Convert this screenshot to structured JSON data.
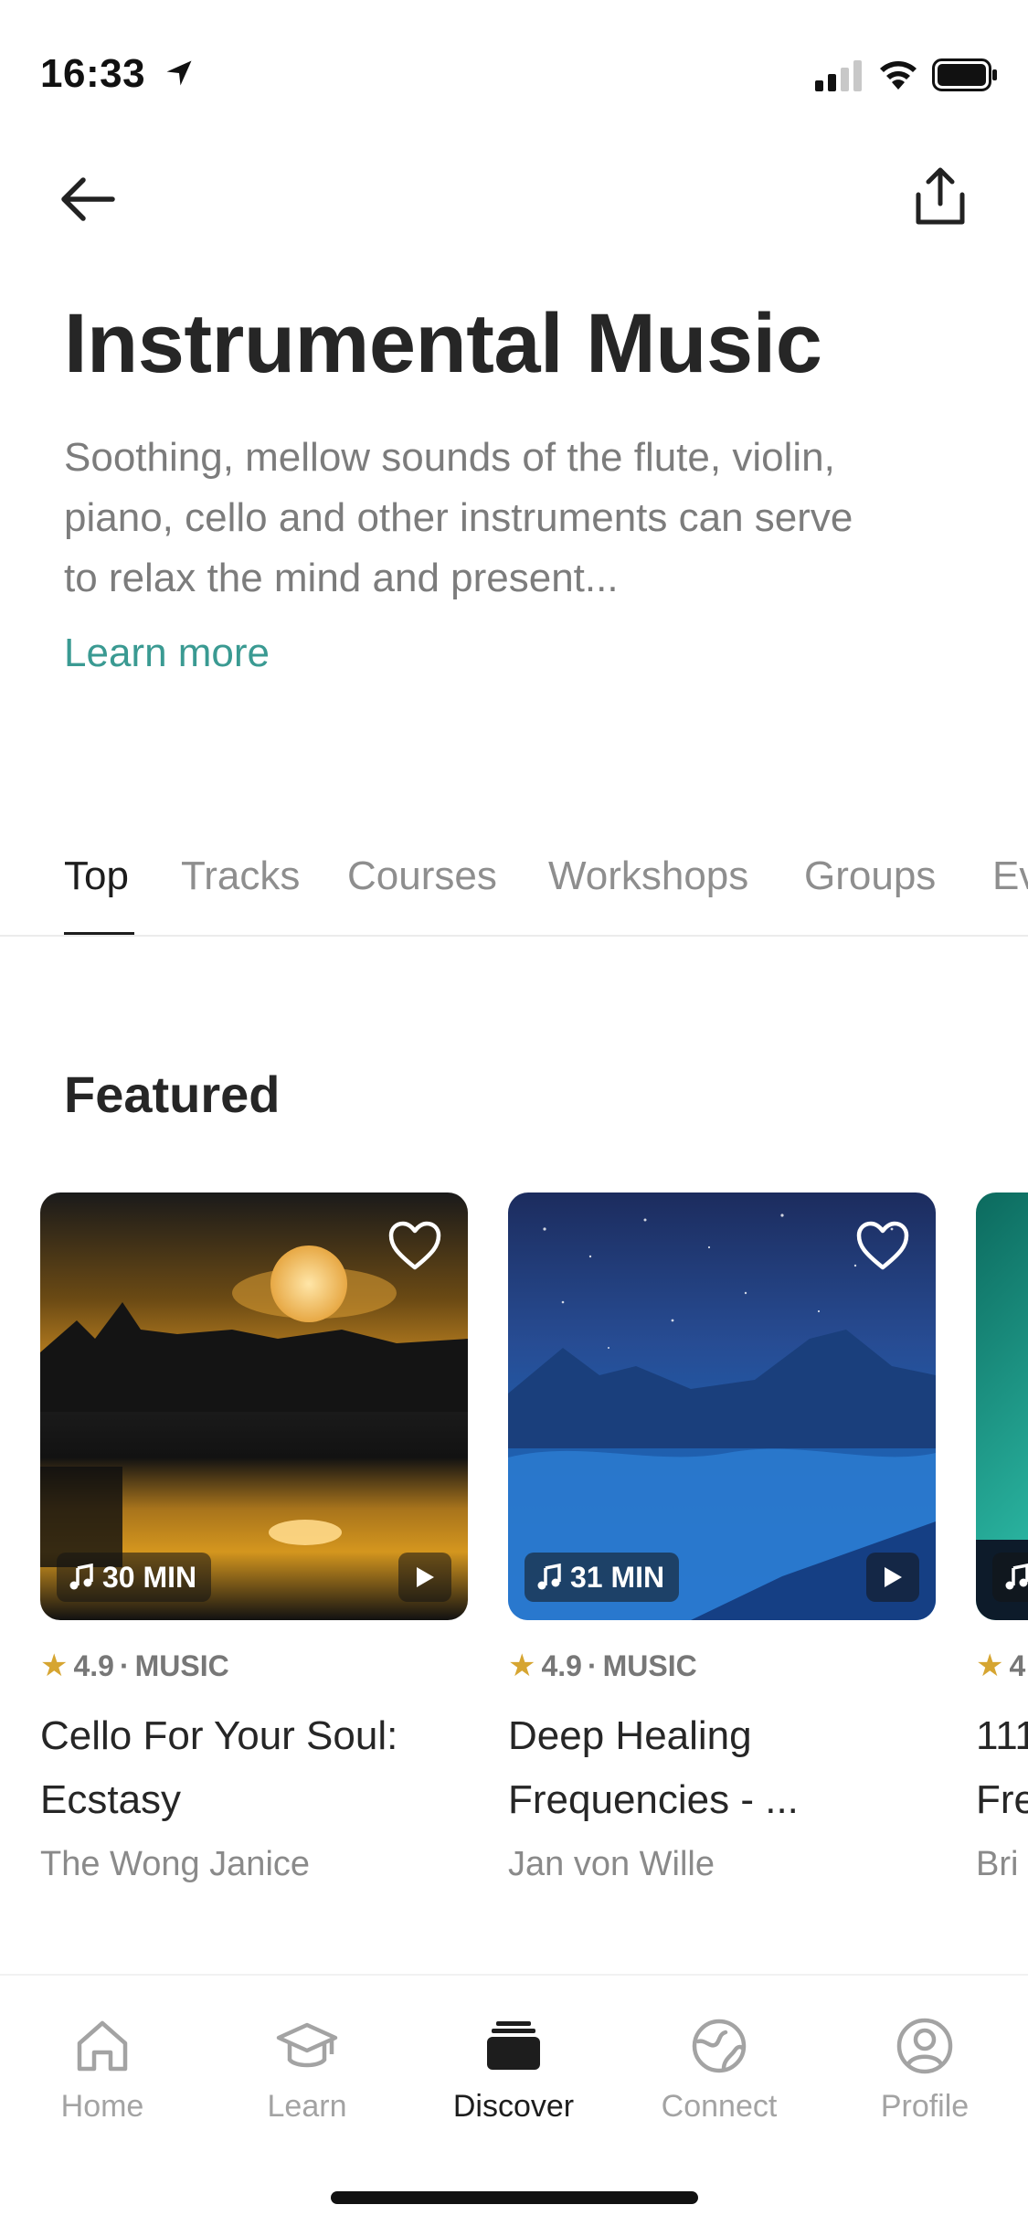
{
  "status_bar": {
    "time": "16:33"
  },
  "header": {
    "title": "Instrumental Music",
    "description": "Soothing, mellow sounds of the flute, violin, piano, cello and other instruments can serve to relax the mind and present...",
    "learn_more": "Learn more"
  },
  "tabs": [
    "Top",
    "Tracks",
    "Courses",
    "Workshops",
    "Groups",
    "Ev"
  ],
  "active_tab": "Top",
  "featured": {
    "title": "Featured",
    "cards": [
      {
        "duration": "30 MIN",
        "rating": "4.9",
        "category": "MUSIC",
        "title": "Cello For Your Soul: Ecstasy",
        "author": "The Wong Janice"
      },
      {
        "duration": "31 MIN",
        "rating": "4.9",
        "category": "MUSIC",
        "title": "Deep Healing Frequencies - ...",
        "author": "Jan von Wille"
      },
      {
        "duration": "",
        "rating": "4",
        "category": "",
        "title": "111\nFre",
        "author": "Bri"
      }
    ]
  },
  "nav": {
    "items": [
      "Home",
      "Learn",
      "Discover",
      "Connect",
      "Profile"
    ],
    "active": "Discover"
  },
  "colors": {
    "accent": "#3a9a92",
    "star": "#d6a531"
  }
}
